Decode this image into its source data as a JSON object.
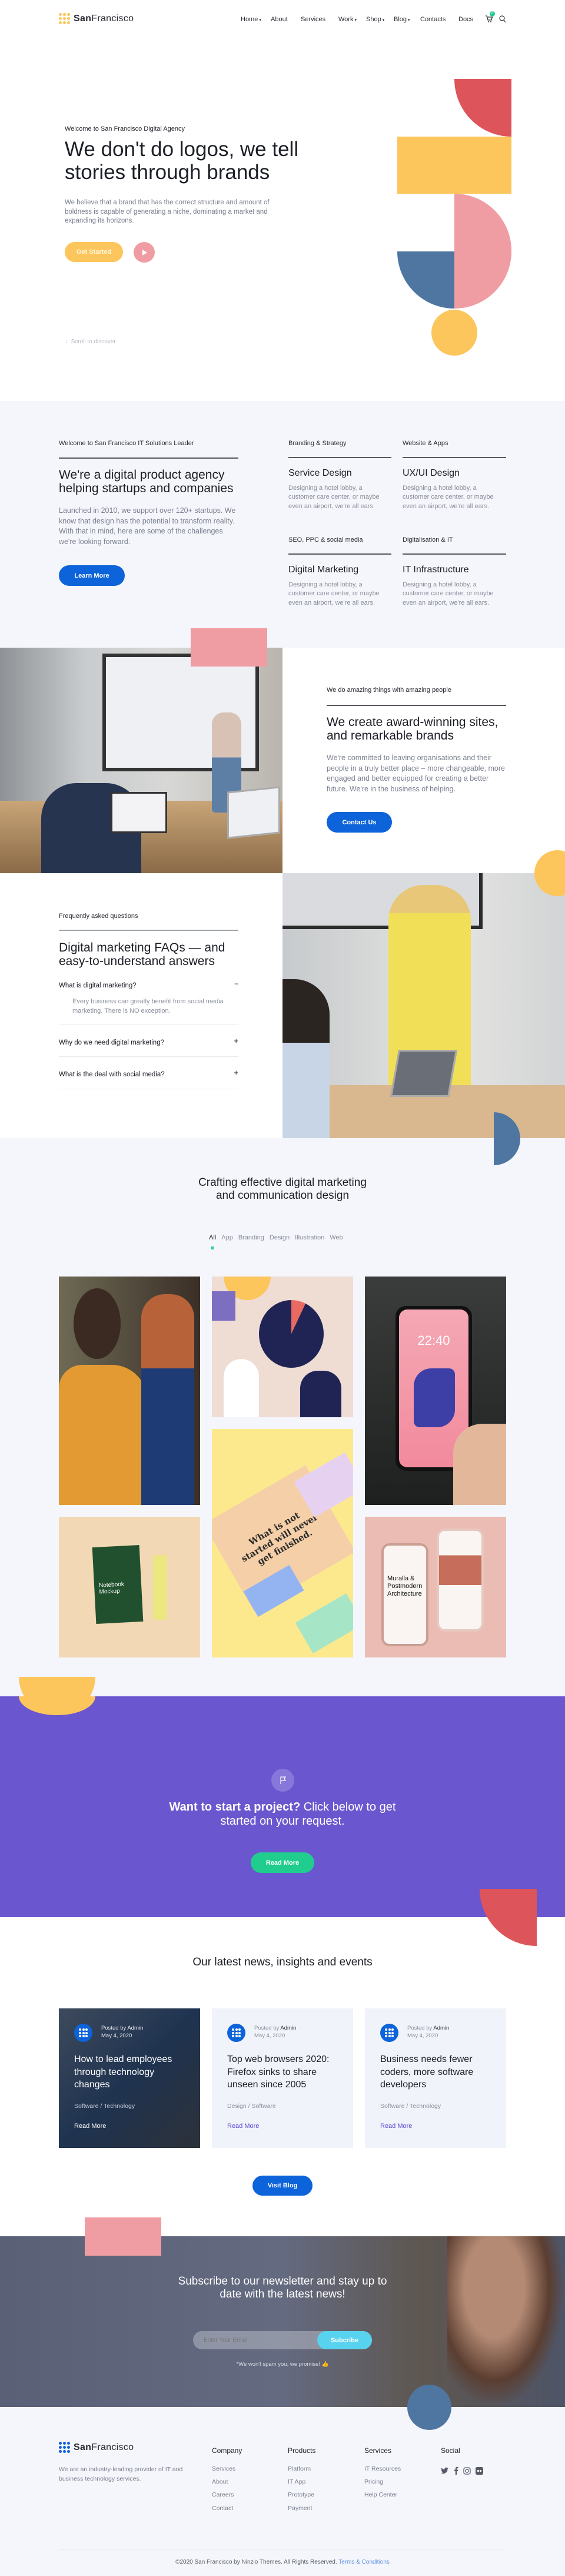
{
  "brand": {
    "name_a": "San",
    "name_b": "Francisco"
  },
  "colors": {
    "yellow": "#fcc65c",
    "red": "#dd555a",
    "pink": "#f09ca3",
    "blue": "#4f76a1",
    "purple": "#6a56cf",
    "green": "#20cc8e",
    "primary": "#0d63d9",
    "cyan": "#58d3ef"
  },
  "nav": {
    "items": [
      "Home",
      "About",
      "Services",
      "Work",
      "Shop",
      "Blog",
      "Contacts",
      "Docs"
    ],
    "cart_count": "0",
    "cart_icon": "cart-icon",
    "search_icon": "search-icon"
  },
  "hero": {
    "label": "Welcome to San Francisco Digital Agency",
    "title": "We don't do logos, we tell stories through brands",
    "text": "We believe that a brand that has the correct structure and amount of boldness is capable of generating a niche, dominating a market and expanding its horizons.",
    "cta": "Get Started",
    "scroll": "Scroll to discover"
  },
  "about": {
    "label": "Welcome to San Francisco IT Solutions Leader",
    "title": "We're a digital product agency helping startups and companies",
    "text": "Launched in 2010, we support over 120+ startups. We know that design has the potential to transform reality. With that in mind, here are some of the challenges we're looking forward.",
    "cta": "Learn More",
    "services": [
      {
        "label": "Branding & Strategy",
        "title": "Service Design",
        "desc": "Designing a hotel lobby, a customer care center, or maybe even an airport, we're all ears."
      },
      {
        "label": "Website & Apps",
        "title": "UX/UI Design",
        "desc": "Designing a hotel lobby, a customer care center, or maybe even an airport, we're all ears."
      },
      {
        "label": "SEO, PPC & social media",
        "title": "Digital Marketing",
        "desc": "Designing a hotel lobby, a customer care center, or maybe even an airport, we're all ears."
      },
      {
        "label": "Digitalisation & IT",
        "title": "IT Infrastructure",
        "desc": "Designing a hotel lobby, a customer care center, or maybe even an airport, we're all ears."
      }
    ]
  },
  "amazing": {
    "label": "We do amazing things with amazing people",
    "title": "We create award-winning sites, and remarkable brands",
    "text": "We're committed to leaving organisations and their people in a truly better place – more changeable, more engaged and better equipped for creating a better future. We're in the business of helping.",
    "cta": "Contact Us"
  },
  "faq": {
    "label": "Frequently asked questions",
    "title": "Digital marketing FAQs — and easy-to-understand answers",
    "items": [
      {
        "q": "What is digital marketing?",
        "a": "Every business can greatly benefit from social media marketing. There is NO exception.",
        "toggle": "−"
      },
      {
        "q": "Why do we need digital marketing?",
        "toggle": "+"
      },
      {
        "q": "What is the deal with social media?",
        "toggle": "+"
      }
    ]
  },
  "portfolio": {
    "title": "Crafting effective digital marketing and communication design",
    "filters": [
      "All",
      "App",
      "Branding",
      "Design",
      "Illustration",
      "Web"
    ],
    "active_filter": "All",
    "tile_text": {
      "phone_time": "22:40",
      "notebook": "Notebook Mockup",
      "poster": "What is not started will never get finished.",
      "architecture": "Muralla & Postmodern Architecture"
    }
  },
  "cta": {
    "bold": "Want to start a project?",
    "rest": " Click below to get started on your request.",
    "button": "Read More",
    "icon": "flag-icon"
  },
  "news": {
    "title": "Our latest news, insights and events",
    "posted_by": "Posted by ",
    "author": "Admin",
    "date": "May 4, 2020",
    "read_more": "Read More",
    "posts": [
      {
        "title": "How to lead employees through technology changes",
        "category": "Software / Technology"
      },
      {
        "title": "Top web browsers 2020: Firefox sinks to share unseen since 2005",
        "category": "Design / Software"
      },
      {
        "title": "Business needs fewer coders, more software developers",
        "category": "Software / Technology"
      }
    ],
    "visit": "Visit Blog"
  },
  "newsletter": {
    "title": "Subscribe to our newsletter and stay up to date with the latest news!",
    "placeholder": "Enter Your Email",
    "button": "Subcribe",
    "note": "*We won't spam you, we promise! 👍"
  },
  "footer": {
    "desc": "We are an industry-leading provider of IT and business technology services.",
    "columns": [
      {
        "title": "Company",
        "links": [
          "Services",
          "About",
          "Careers",
          "Contact"
        ]
      },
      {
        "title": "Products",
        "links": [
          "Platform",
          "IT App",
          "Prototype",
          "Payment"
        ]
      },
      {
        "title": "Services",
        "links": [
          "IT Resources",
          "Pricing",
          "Help Center"
        ]
      }
    ],
    "social_title": "Social",
    "social": [
      "twitter-icon",
      "facebook-icon",
      "instagram-icon",
      "flickr-icon"
    ],
    "copyright": "©2020 San Francisco by Ninzio Themes. All Rights Reserved.",
    "terms": "Terms & Conditions"
  }
}
